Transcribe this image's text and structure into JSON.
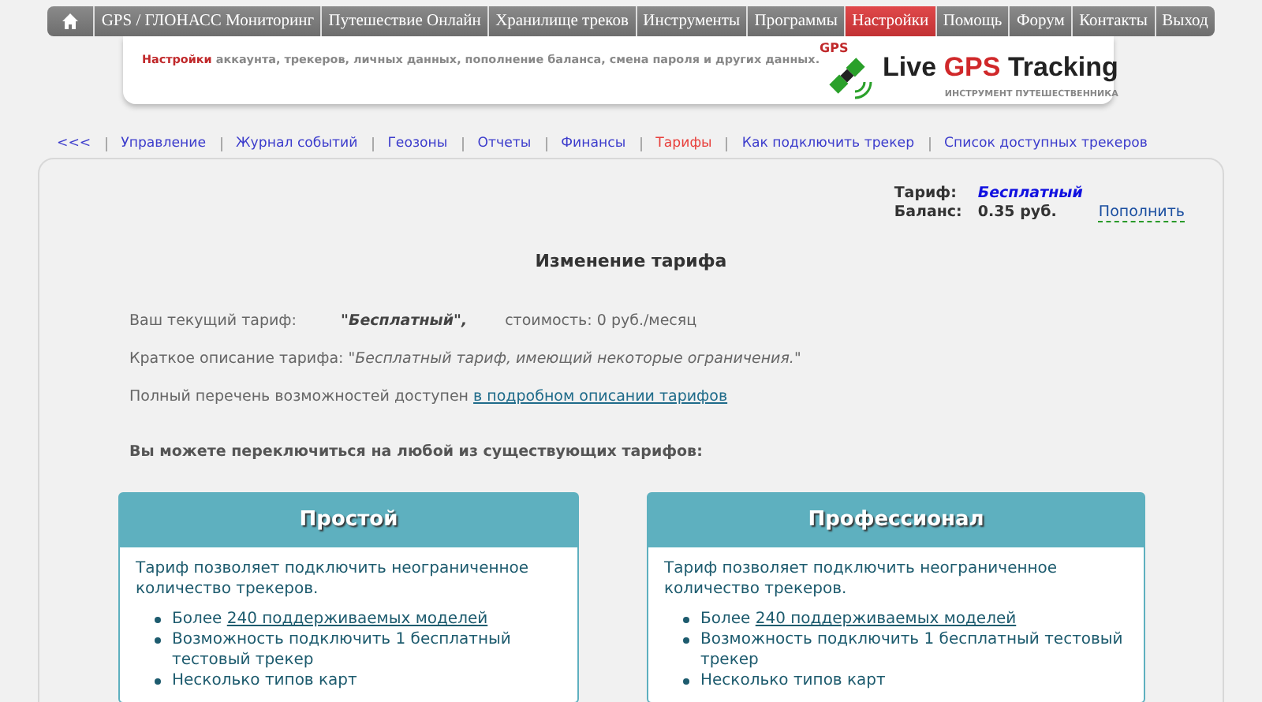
{
  "top_nav": [
    {
      "kind": "home",
      "selected": false
    },
    {
      "kind": "text",
      "label": "GPS / ГЛОНАСС Мониторинг",
      "selected": false
    },
    {
      "kind": "text",
      "label": "Путешествие Онлайн",
      "selected": false
    },
    {
      "kind": "text",
      "label": "Хранилище треков",
      "selected": false
    },
    {
      "kind": "text",
      "label": "Инструменты",
      "selected": false
    },
    {
      "kind": "text",
      "label": "Программы",
      "selected": false
    },
    {
      "kind": "text",
      "label": "Настройки",
      "selected": true
    },
    {
      "kind": "text",
      "label": "Помощь",
      "selected": false
    },
    {
      "kind": "text",
      "label": "Форум",
      "selected": false
    },
    {
      "kind": "text",
      "label": "Контакты",
      "selected": false
    },
    {
      "kind": "text",
      "label": "Выход",
      "selected": false
    }
  ],
  "banner": {
    "highlight": "Настройки",
    "text": "аккаунта, трекеров, личных данных, пополнение баланса, смена пароля и других данных.",
    "logo_badge": "GPS",
    "logo_title": [
      {
        "text": "Live",
        "accent": false
      },
      {
        "text": "GPS",
        "accent": true
      },
      {
        "text": "Tracking",
        "accent": false
      }
    ],
    "logo_subtitle": "ИНСТРУМЕНТ ПУТЕШЕСТВЕННИКА"
  },
  "sub_nav": [
    {
      "label": "<<<",
      "selected": false
    },
    {
      "label": "Управление",
      "selected": false
    },
    {
      "label": "Журнал событий",
      "selected": false
    },
    {
      "label": "Геозоны",
      "selected": false
    },
    {
      "label": "Отчеты",
      "selected": false
    },
    {
      "label": "Финансы",
      "selected": false
    },
    {
      "label": "Тарифы",
      "selected": true
    },
    {
      "label": "Как подключить трекер",
      "selected": false
    },
    {
      "label": "Список доступных трекеров",
      "selected": false
    }
  ],
  "account": {
    "tariff_label": "Тариф:",
    "tariff_value": "Бесплатный",
    "balance_label": "Баланс:",
    "balance_value": "0.35 руб.",
    "top_up": "Пополнить"
  },
  "heading": "Изменение тарифа",
  "current": {
    "label": "Ваш текущий тариф:",
    "name": "\"Бесплатный\",",
    "cost": "стоимость: 0 руб./месяц"
  },
  "description": "Краткое описание тарифа: \"*Бесплатный тариф, имеющий некоторые ограничения.*\"",
  "details": {
    "text": "Полный перечень возможностей доступен",
    "link": "в подробном описании тарифов"
  },
  "switch_prompt": "Вы можете переключиться на любой из существующих тарифов:",
  "plans": [
    {
      "title": "Простой",
      "intro": "Тариф позволяет подключить неограниченное количество трекеров.",
      "features": [
        {
          "text": "Более",
          "link": "240 поддерживаемых моделей"
        },
        {
          "text": "Возможность подключить 1 бесплатный тестовый трекер"
        },
        {
          "text": "Несколько типов карт"
        }
      ]
    },
    {
      "title": "Профессионал",
      "intro": "Тариф позволяет подключить неограниченное количество трекеров.",
      "features": [
        {
          "text": "Более",
          "link": "240 поддерживаемых моделей"
        },
        {
          "text": "Возможность подключить 1 бесплатный тестовый трекер"
        },
        {
          "text": "Несколько типов карт"
        }
      ]
    }
  ]
}
